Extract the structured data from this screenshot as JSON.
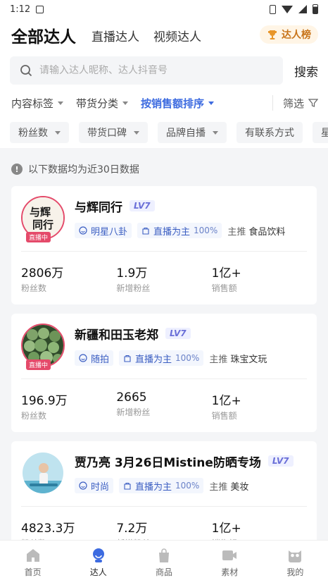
{
  "status_bar": {
    "time": "1:12"
  },
  "header": {
    "tabs": [
      {
        "label": "全部达人"
      },
      {
        "label": "直播达人"
      },
      {
        "label": "视频达人"
      }
    ],
    "rank_button": "达人榜"
  },
  "search": {
    "placeholder": "请输入达人昵称、达人抖音号",
    "button": "搜索"
  },
  "filters": {
    "items": [
      {
        "label": "内容标签"
      },
      {
        "label": "带货分类"
      },
      {
        "label": "按销售额排序"
      }
    ],
    "screen_label": "筛选"
  },
  "chips": [
    {
      "label": "粉丝数"
    },
    {
      "label": "带货口碑"
    },
    {
      "label": "品牌自播"
    },
    {
      "label": "有联系方式"
    },
    {
      "label": "星"
    }
  ],
  "notice": "以下数据均为近30日数据",
  "live_tag": "直播中",
  "avatar_text": "与辉同行",
  "cards": [
    {
      "name": "与辉同行",
      "level": "LV7",
      "category_tag": "明星八卦",
      "mode": "直播为主",
      "mode_pct": "100%",
      "main_label": "主推",
      "main_value": "食品饮料",
      "stats": [
        {
          "value": "2806万",
          "label": "粉丝数"
        },
        {
          "value": "1.9万",
          "label": "新增粉丝"
        },
        {
          "value": "1亿+",
          "label": "销售额"
        }
      ]
    },
    {
      "name": "新疆和田玉老郑",
      "level": "LV7",
      "category_tag": "随拍",
      "mode": "直播为主",
      "mode_pct": "100%",
      "main_label": "主推",
      "main_value": "珠宝文玩",
      "stats": [
        {
          "value": "196.9万",
          "label": "粉丝数"
        },
        {
          "value": "2665",
          "label": "新增粉丝"
        },
        {
          "value": "1亿+",
          "label": "销售额"
        }
      ]
    },
    {
      "name": "贾乃亮 3月26日Mistine防晒专场",
      "level": "LV7",
      "category_tag": "时尚",
      "mode": "直播为主",
      "mode_pct": "100%",
      "main_label": "主推",
      "main_value": "美妆",
      "stats": [
        {
          "value": "4823.3万",
          "label": "粉丝数"
        },
        {
          "value": "7.2万",
          "label": "新增粉丝"
        },
        {
          "value": "1亿+",
          "label": "销售额"
        }
      ]
    }
  ],
  "bottom_nav": [
    {
      "label": "首页",
      "icon": "home-icon"
    },
    {
      "label": "达人",
      "icon": "talent-icon"
    },
    {
      "label": "商品",
      "icon": "bag-icon"
    },
    {
      "label": "素材",
      "icon": "video-icon"
    },
    {
      "label": "我的",
      "icon": "owl-icon"
    }
  ],
  "colors": {
    "accent": "#3d6be0",
    "live": "#e44a6a",
    "rank": "#c8741a"
  }
}
